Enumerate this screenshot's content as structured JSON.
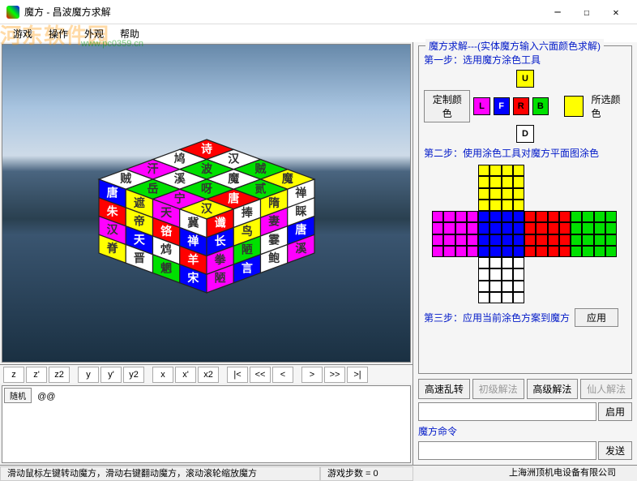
{
  "titlebar": {
    "title": "魔方 - 昌波魔方求解"
  },
  "menubar": {
    "items": [
      "游戏",
      "操作",
      "外观",
      "帮助"
    ],
    "watermark": "河东软件园",
    "watermark_url": "www.pc0359.cn"
  },
  "controls": {
    "buttons": [
      "z",
      "z'",
      "z2",
      "y",
      "y'",
      "y2",
      "x",
      "x'",
      "x2"
    ],
    "nav": [
      "|<",
      "<<",
      "<",
      ">",
      ">>",
      ">|"
    ]
  },
  "log": {
    "tab": "随机",
    "text": "@@"
  },
  "solve_panel": {
    "legend": "魔方求解---(实体魔方输入六面颜色求解)",
    "step1": "第一步：选用魔方涂色工具",
    "step2": "第二步：使用涂色工具对魔方平面图涂色",
    "step3": "第三步：应用当前涂色方案到魔方",
    "apply": "应用",
    "custom_color": "定制颜色",
    "selected_color": "所选颜色",
    "faces": {
      "U": "U",
      "L": "L",
      "F": "F",
      "R": "R",
      "B": "B",
      "D": "D"
    },
    "face_colors": {
      "U": "#ffff00",
      "L": "#ff00ff",
      "F": "#0000ff",
      "R": "#ff0000",
      "B": "#00e000",
      "D": "#ffffff"
    },
    "selected": "#ffff00"
  },
  "algo": {
    "scramble": "高速乱转",
    "basic": "初级解法",
    "advanced": "高级解法",
    "master": "仙人解法",
    "enable": "启用",
    "cmd_label": "魔方命令",
    "send": "发送"
  },
  "statusbar": {
    "hint": "滑动鼠标左键转动魔方，滑动右键翻动魔方，滚动滚轮缩放魔方",
    "steps": "游戏步数 = 0",
    "company": "上海洲顶机电设备有限公司"
  },
  "cube3d": {
    "top_chars": [
      [
        "诗",
        "汉",
        "贼",
        "魔"
      ],
      [
        "鸠",
        "波",
        "魔",
        "贰"
      ],
      [
        "汗",
        "溪",
        "呀",
        "唐"
      ],
      [
        "贼",
        "岳",
        "宁",
        "汉"
      ]
    ],
    "top_colors": [
      [
        "#ff0000",
        "#ffffff",
        "#00e000",
        "#ffff00"
      ],
      [
        "#ffffff",
        "#00e000",
        "#ffffff",
        "#00e000"
      ],
      [
        "#ff00ff",
        "#ffffff",
        "#00e000",
        "#ff0000"
      ],
      [
        "#ffffff",
        "#00e000",
        "#ff00ff",
        "#ffff00"
      ]
    ],
    "front_chars": [
      [
        "唐",
        "遮",
        "天",
        "冀"
      ],
      [
        "朱",
        "帝",
        "铬",
        "禅"
      ],
      [
        "汉",
        "天",
        "鸩",
        "羊"
      ],
      [
        "脊",
        "晋",
        "魍",
        "宋"
      ]
    ],
    "front_colors": [
      [
        "#0000ff",
        "#ffff00",
        "#ff00ff",
        "#ffffff"
      ],
      [
        "#ff0000",
        "#ffff00",
        "#ff0000",
        "#0000ff"
      ],
      [
        "#ff00ff",
        "#0000ff",
        "#ffffff",
        "#ff0000"
      ],
      [
        "#ffff00",
        "#ffffff",
        "#00e000",
        "#0000ff"
      ]
    ],
    "right_chars": [
      [
        "谶",
        "捧",
        "隋",
        "禅"
      ],
      [
        "长",
        "鸟",
        "妻",
        "睬"
      ],
      [
        "拳",
        "陋",
        "霎",
        "唐"
      ],
      [
        "陋",
        "言",
        "鲍",
        "溪"
      ]
    ],
    "right_colors": [
      [
        "#ff0000",
        "#ffffff",
        "#ffff00",
        "#ffffff"
      ],
      [
        "#0000ff",
        "#ffff00",
        "#ff00ff",
        "#ffffff"
      ],
      [
        "#ff00ff",
        "#00e000",
        "#ffffff",
        "#0000ff"
      ],
      [
        "#ff00ff",
        "#0000ff",
        "#ffffff",
        "#ff00ff"
      ]
    ]
  }
}
